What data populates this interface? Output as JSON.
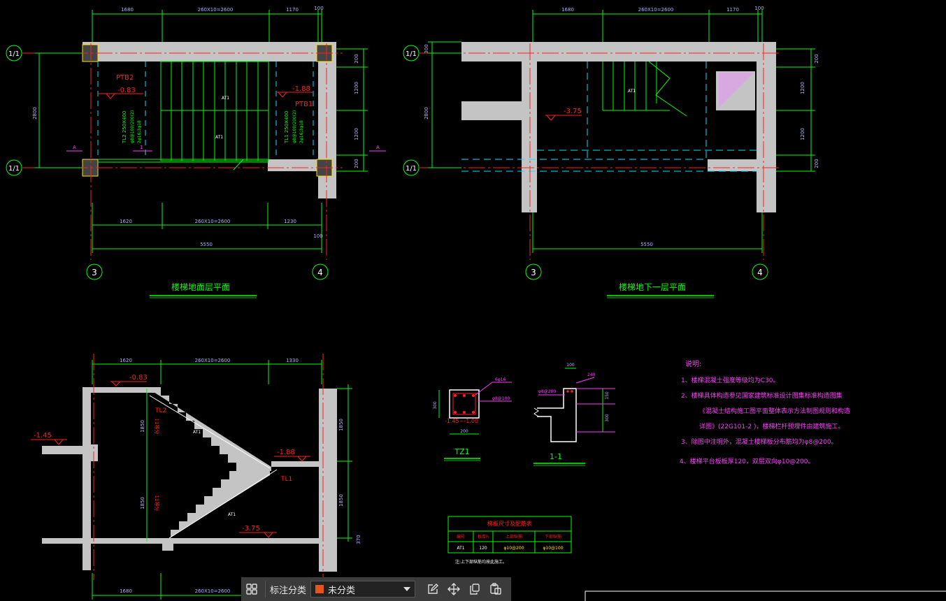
{
  "colors": {
    "background": "#000000",
    "wall": "#c4c4c4",
    "axis": "#ff2020",
    "dimension": "#00ff00",
    "dimension_text": "#b0b0ff",
    "title": "#00ff00",
    "notes": "#ff3cff",
    "label_red": "#ff2020",
    "axis_bubble": "#00ff00",
    "stair": "#00ff00",
    "selection": "#ffe000",
    "toolbar_swatch": "#e8531a"
  },
  "plan1": {
    "title": "楼梯地面层平面",
    "axis_left_top": "1/1",
    "axis_left_bottom": "1/1",
    "axis_b1": "3",
    "axis_b2": "4",
    "dim_top": [
      "1680",
      "260X10=2600",
      "1170",
      "100"
    ],
    "dim_bottom_seg": [
      "1620",
      "260X10=2600",
      "1230"
    ],
    "dim_bottom_total": "5550",
    "dim_bottom_small": "100",
    "dim_left": "2800",
    "dim_right": [
      "200",
      "1200",
      "1200",
      "200"
    ],
    "labels": {
      "ptb2": "PTB2",
      "elev_left": "-0.83",
      "elev_right": "-1.88",
      "ptb1": "PTB1",
      "at1_top": "AT1",
      "at1_bot": "AT1",
      "section_a_left": "A",
      "section_a_right": "A",
      "section_1": "1",
      "tl2_text": "TL2  250X400",
      "tl2_sub1": "φ8@100/200(2)",
      "tl2_sub2": "2φ16;3φ18",
      "tl1_text": "TL1  250X400",
      "tl1_sub1": "φ8@100/200(2)",
      "tl1_sub2": "2φ16;3φ18"
    }
  },
  "plan2": {
    "title": "楼梯地下一层平面",
    "axis_left_top": "1/1",
    "axis_left_bottom": "1/1",
    "axis_b1": "3",
    "axis_b2": "4",
    "dim_top": [
      "1680",
      "260X10=2600",
      "1170",
      "100"
    ],
    "dim_bottom_total": "5550",
    "dim_left": "2800",
    "dim_left_small": "300",
    "dim_right": [
      "200",
      "1200",
      "1200",
      "200"
    ],
    "labels": {
      "at1": "AT1",
      "elev": "-3.75"
    }
  },
  "section": {
    "dim_top": [
      "1620",
      "260X10=2600",
      "1330"
    ],
    "dim_bottom": [
      "1680",
      "260X10=2600"
    ],
    "dim_right": [
      "1850",
      "1850",
      "370"
    ],
    "labels": {
      "elev_top": "-0.83",
      "elev_left": "-1.45",
      "elev_mid": "-1.88",
      "elev_bottom": "-3.75",
      "tl2": "TL2",
      "tl1": "TL1",
      "at1_top": "AT1",
      "at1_bot": "AT1",
      "steps_top": "11等分",
      "steps_bot": "11等分",
      "h_top": "1850",
      "h_bot": "1850"
    }
  },
  "tz1": {
    "title": "TZ1",
    "size_w": "200",
    "size_h": "300",
    "rebar": "6φ16",
    "stirrup": "φ8@100",
    "elev": "-1.45~-1.00"
  },
  "detail11": {
    "title": "1-1",
    "dim_top": "100",
    "dim_top2": "240",
    "rebar": "φ8@200",
    "dim_side1": "150",
    "dim_side2": "300"
  },
  "table": {
    "title": "梯板尺寸及配筋表",
    "headers": [
      "编号",
      "板厚h",
      "上部纵筋",
      "下部纵筋"
    ],
    "rows": [
      [
        "AT1",
        "120",
        "φ10@200",
        "φ10@100"
      ]
    ],
    "footnote": "注:上下部纵筋均按此施工。"
  },
  "notes": {
    "title": "说明:",
    "lines": [
      "1、楼梯混凝土强度等级均为C30。",
      "2、楼梯具体构造参见国家建筑标准设计图集标准构造图集",
      "《混凝土结构施工图平面整体表示方法制图规则和构造",
      "详图》(22G101-2 )，楼梯栏杆预埋件由建筑施工。",
      "3、除图中注明外，混凝土楼梯板分布筋均为φ8@200。",
      "4、楼梯平台板板厚120，双层双向φ10@200。"
    ]
  },
  "toolbar": {
    "grid_icon": "grid-icon",
    "label": "标注分类",
    "select_value": "未分类",
    "edit_icon": "edit-icon",
    "move_icon": "move-icon",
    "copy_icon": "copy-icon",
    "paste_icon": "paste-icon"
  }
}
